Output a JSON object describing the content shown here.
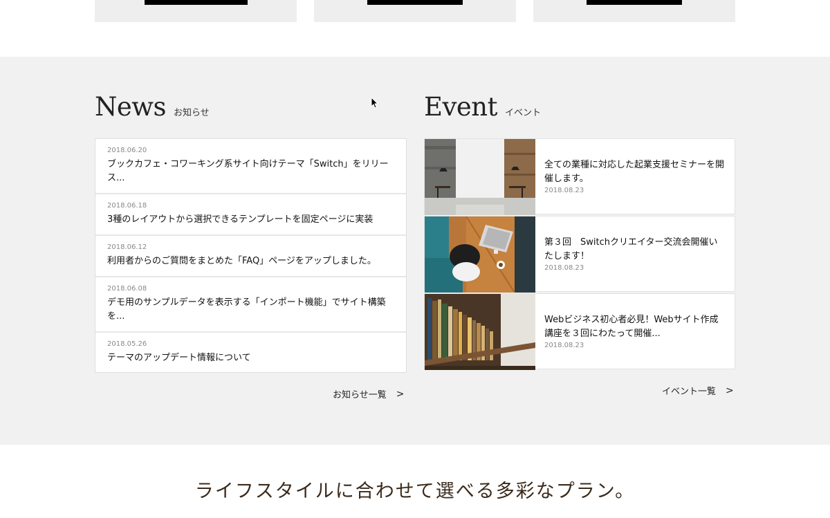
{
  "news": {
    "heading_en": "News",
    "heading_ja": "お知らせ",
    "items": [
      {
        "date": "2018.06.20",
        "title": "ブックカフェ・コワーキング系サイト向けテーマ「Switch」をリリース..."
      },
      {
        "date": "2018.06.18",
        "title": "3種のレイアウトから選択できるテンプレートを固定ページに実装"
      },
      {
        "date": "2018.06.12",
        "title": "利用者からのご質問をまとめた「FAQ」ページをアップしました。"
      },
      {
        "date": "2018.06.08",
        "title": "デモ用のサンプルデータを表示する「インポート機能」でサイト構築を..."
      },
      {
        "date": "2018.05.26",
        "title": "テーマのアップデート情報について"
      }
    ],
    "more_label": "お知らせ一覧",
    "more_arrow": ">"
  },
  "event": {
    "heading_en": "Event",
    "heading_ja": "イベント",
    "items": [
      {
        "title": "全ての業種に対応した起業支援セミナーを開催します。",
        "date": "2018.08.23",
        "thumb": "office-interior"
      },
      {
        "title": "第３回　Switchクリエイター交流会開催いたします！",
        "date": "2018.08.23",
        "thumb": "laptop-cafe"
      },
      {
        "title": "Webビジネス初心者必見！Webサイト作成講座を３回にわたって開催...",
        "date": "2018.08.23",
        "thumb": "bookshelf"
      }
    ],
    "more_label": "イベント一覧",
    "more_arrow": ">"
  },
  "plan": {
    "heading": "ライフスタイルに合わせて選べる多彩なプラン。"
  },
  "colors": {
    "section_bg": "#f1f1f1",
    "card_bg": "#ffffff",
    "plan_heading": "#3a2a1c"
  }
}
